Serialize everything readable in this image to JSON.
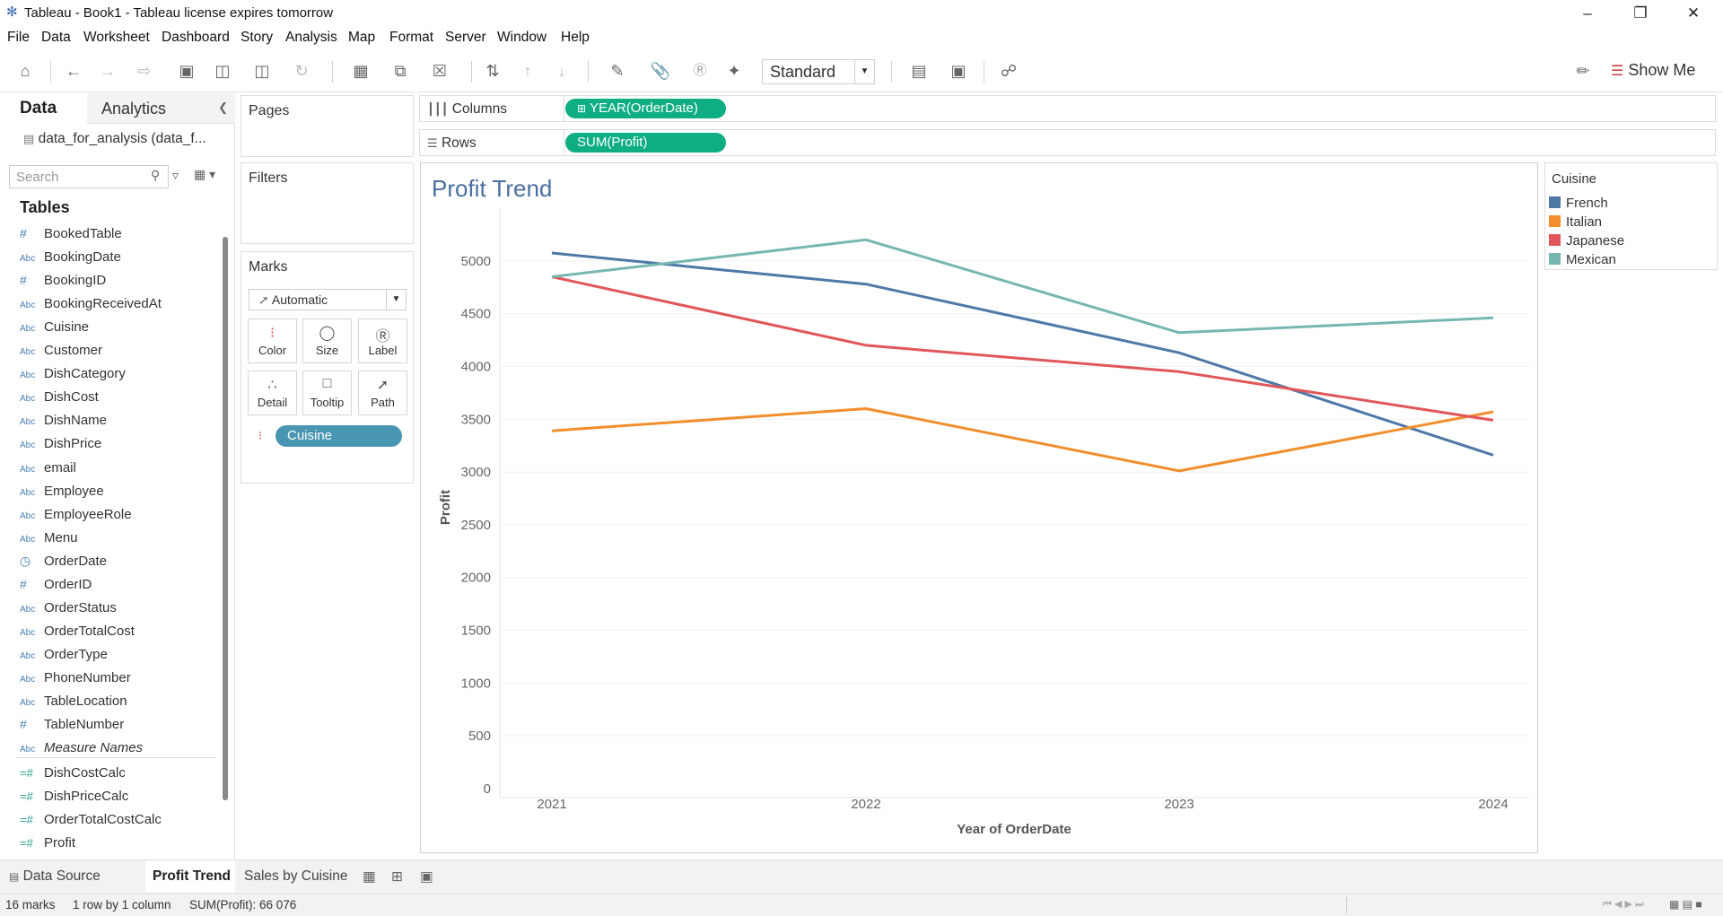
{
  "window": {
    "title": "Tableau - Book1 - Tableau license expires tomorrow"
  },
  "menu": [
    "File",
    "Data",
    "Worksheet",
    "Dashboard",
    "Story",
    "Analysis",
    "Map",
    "Format",
    "Server",
    "Window",
    "Help"
  ],
  "toolbar": {
    "fit": "Standard",
    "show_me": "Show Me"
  },
  "left_pane": {
    "tab_data": "Data",
    "tab_analytics": "Analytics",
    "datasource": "data_for_analysis (data_f...",
    "search_placeholder": "Search",
    "tables_header": "Tables",
    "fields": [
      {
        "name": "BookedTable",
        "type": "#"
      },
      {
        "name": "BookingDate",
        "type": "Abc"
      },
      {
        "name": "BookingID",
        "type": "#"
      },
      {
        "name": "BookingReceivedAt",
        "type": "Abc"
      },
      {
        "name": "Cuisine",
        "type": "Abc"
      },
      {
        "name": "Customer",
        "type": "Abc"
      },
      {
        "name": "DishCategory",
        "type": "Abc"
      },
      {
        "name": "DishCost",
        "type": "Abc"
      },
      {
        "name": "DishName",
        "type": "Abc"
      },
      {
        "name": "DishPrice",
        "type": "Abc"
      },
      {
        "name": "email",
        "type": "Abc"
      },
      {
        "name": "Employee",
        "type": "Abc"
      },
      {
        "name": "EmployeeRole",
        "type": "Abc"
      },
      {
        "name": "Menu",
        "type": "Abc"
      },
      {
        "name": "OrderDate",
        "type": "date"
      },
      {
        "name": "OrderID",
        "type": "#"
      },
      {
        "name": "OrderStatus",
        "type": "Abc"
      },
      {
        "name": "OrderTotalCost",
        "type": "Abc"
      },
      {
        "name": "OrderType",
        "type": "Abc"
      },
      {
        "name": "PhoneNumber",
        "type": "Abc"
      },
      {
        "name": "TableLocation",
        "type": "Abc"
      },
      {
        "name": "TableNumber",
        "type": "#"
      },
      {
        "name": "Measure Names",
        "type": "Abc"
      },
      {
        "name": "DishCostCalc",
        "type": "calc"
      },
      {
        "name": "DishPriceCalc",
        "type": "calc"
      },
      {
        "name": "OrderTotalCostCalc",
        "type": "calc"
      },
      {
        "name": "Profit",
        "type": "calc"
      }
    ]
  },
  "cards": {
    "pages": "Pages",
    "filters": "Filters",
    "marks": "Marks",
    "mark_type": "Automatic",
    "mark_buttons": [
      "Color",
      "Size",
      "Label",
      "Detail",
      "Tooltip",
      "Path"
    ],
    "color_pill": "Cuisine"
  },
  "shelves": {
    "columns_label": "Columns",
    "columns_pill": "YEAR(OrderDate)",
    "rows_label": "Rows",
    "rows_pill": "SUM(Profit)"
  },
  "legend": {
    "title": "Cuisine",
    "items": [
      {
        "name": "French",
        "color": "#4e79a7"
      },
      {
        "name": "Italian",
        "color": "#f28e2b"
      },
      {
        "name": "Japanese",
        "color": "#e15759"
      },
      {
        "name": "Mexican",
        "color": "#76b7b2"
      }
    ]
  },
  "chart_data": {
    "type": "line",
    "title": "Profit Trend",
    "xlabel": "Year of OrderDate",
    "ylabel": "Profit",
    "categories": [
      "2021",
      "2022",
      "2023",
      "2024"
    ],
    "ylim": [
      0,
      5500
    ],
    "yticks": [
      0,
      500,
      1000,
      1500,
      2000,
      2500,
      3000,
      3500,
      4000,
      4500,
      5000
    ],
    "grid": true,
    "series": [
      {
        "name": "French",
        "color": "#4e79a7",
        "values": [
          5075,
          4780,
          4130,
          3160
        ]
      },
      {
        "name": "Italian",
        "color": "#f28e2b",
        "values": [
          3390,
          3600,
          3010,
          3570
        ]
      },
      {
        "name": "Japanese",
        "color": "#e15759",
        "values": [
          4850,
          4200,
          3950,
          3490
        ]
      },
      {
        "name": "Mexican",
        "color": "#76b7b2",
        "values": [
          4850,
          5200,
          4320,
          4460
        ]
      }
    ]
  },
  "sheet_tabs": {
    "data_source": "Data Source",
    "sheets": [
      "Profit Trend",
      "Sales by Cuisine"
    ],
    "active": "Profit Trend"
  },
  "status": {
    "marks": "16 marks",
    "dims": "1 row by 1 column",
    "sum": "SUM(Profit): 66 076"
  }
}
